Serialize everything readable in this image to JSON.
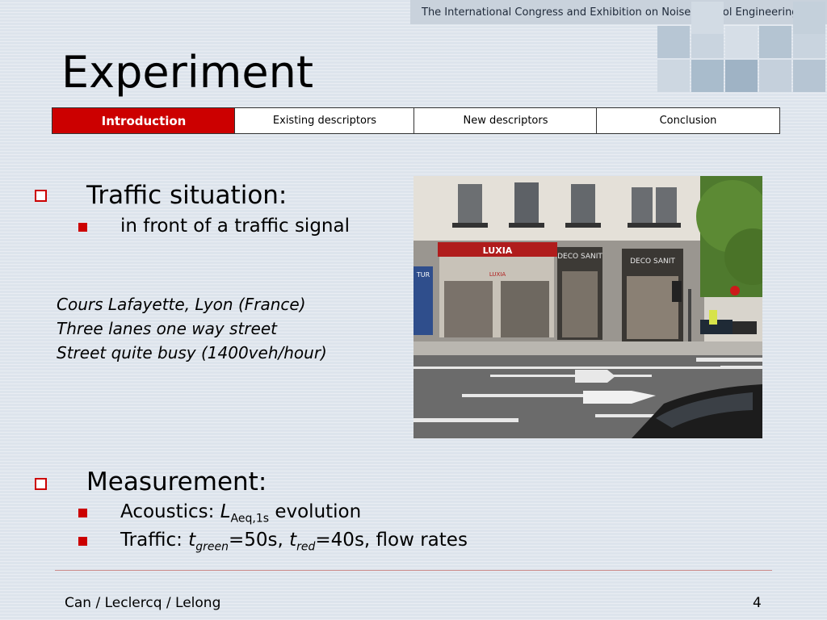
{
  "header": {
    "conference": "The International Congress and Exhibition on Noise Control Engineering"
  },
  "slide": {
    "title": "Experiment",
    "tabs": [
      {
        "label": "Introduction",
        "active": true
      },
      {
        "label": "Existing descriptors",
        "active": false
      },
      {
        "label": "New descriptors",
        "active": false
      },
      {
        "label": "Conclusion",
        "active": false
      }
    ],
    "section1": {
      "heading": "Traffic situation:",
      "item": "in front of a traffic signal"
    },
    "notes": [
      "Cours Lafayette, Lyon (France)",
      "Three lanes one way street",
      "Street quite busy (1400veh/hour)"
    ],
    "photo": {
      "sign1": "LUXIA",
      "sign2": "DECO SANIT",
      "sign3": "DECO SANIT",
      "sign4": "TUR",
      "subsign": "LUXIA"
    },
    "section2": {
      "heading": "Measurement:",
      "acoustics_prefix": "Acoustics: ",
      "acoustics_var": "L",
      "acoustics_sub": "Aeq,1s",
      "acoustics_suffix": " evolution",
      "traffic_prefix": "Traffic: ",
      "traffic_t1": "t",
      "traffic_sub1": "green",
      "traffic_mid": "=50s, ",
      "traffic_t2": "t",
      "traffic_sub2": "red",
      "traffic_suffix": "=40s, flow rates"
    }
  },
  "footer": {
    "authors": "Can / Leclercq / Lelong",
    "page": "4"
  },
  "colors": {
    "accent": "#cc0000",
    "background": "#dde4ec"
  }
}
